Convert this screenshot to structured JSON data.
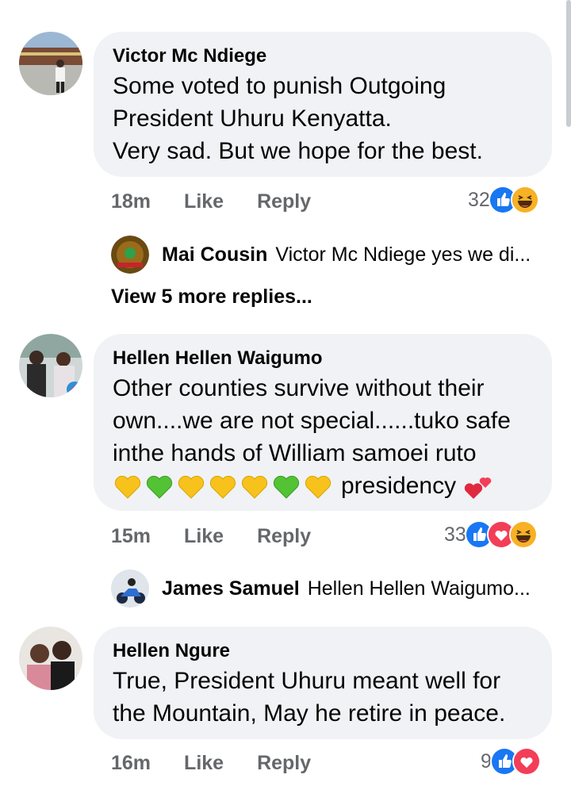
{
  "comments": [
    {
      "author": "Victor Mc Ndiege",
      "text": "Some voted to punish Outgoing\nPresident Uhuru Kenyatta.\nVery sad. But we hope for the best.",
      "time": "18m",
      "like_label": "Like",
      "reply_label": "Reply",
      "reaction_count": "32",
      "reactions": [
        "like-icon",
        "haha-icon"
      ],
      "reply_preview": {
        "name": "Mai Cousin",
        "text": "Victor Mc Ndiege yes we di..."
      },
      "view_more": "View 5 more replies..."
    },
    {
      "author": "Hellen Hellen Waigumo",
      "text": "Other counties survive without their\nown....we are not special......tuko safe\ninthe hands of William samoei ruto",
      "emoji_suffix": "presidency",
      "emoji_hearts": [
        "yellow",
        "green",
        "yellow",
        "yellow",
        "yellow",
        "green",
        "yellow"
      ],
      "time": "15m",
      "like_label": "Like",
      "reply_label": "Reply",
      "reaction_count": "33",
      "reactions": [
        "like-icon",
        "love-icon",
        "haha-icon"
      ],
      "reply_preview": {
        "name": "James Samuel",
        "text": "Hellen Hellen Waigumo..."
      }
    },
    {
      "author": "Hellen Ngure",
      "text": "True,  President Uhuru meant well for\nthe Mountain, May he retire in peace.",
      "time": "16m",
      "like_label": "Like",
      "reply_label": "Reply",
      "reaction_count": "9",
      "reactions": [
        "like-icon",
        "love-icon"
      ]
    }
  ],
  "colors": {
    "bubble": "#f0f2f5",
    "secondary_text": "#65676b",
    "like_blue": "#1877f2",
    "love_red": "#f33e58",
    "haha_yellow": "#f7b125"
  }
}
